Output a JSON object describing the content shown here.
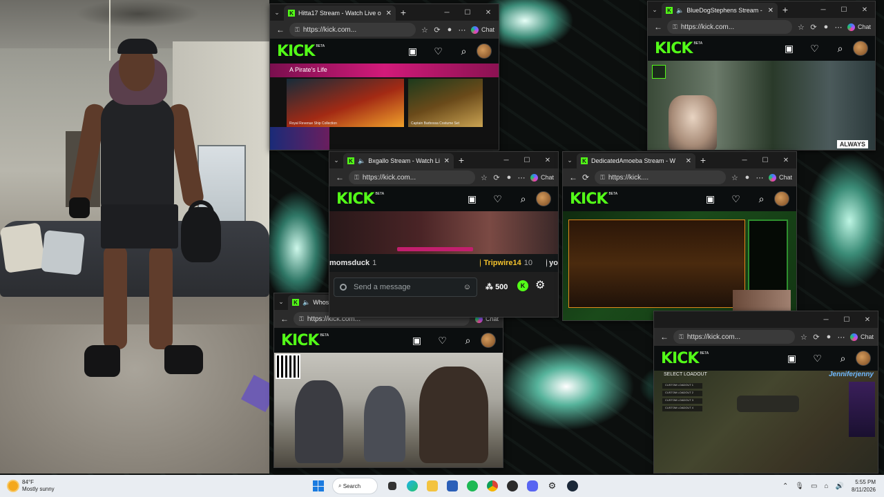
{
  "windows": {
    "hitta": {
      "title": "Hitta17 Stream - Watch Live o",
      "url": "https://kick.com...",
      "banner": "A Pirate's Life",
      "caption1": "Royal Revenue Ship Collection",
      "caption2": "Captain Barbossa Costume Set"
    },
    "blue": {
      "title": "BlueDogStephens Stream - W",
      "url": "https://kick.com...",
      "overlay": "ALWAYS"
    },
    "bxg": {
      "title": "Bxgallo Stream - Watch Live o",
      "url": "https://kick.com...",
      "chat_user": "momsduck",
      "chat_num": "1",
      "chat_user2": "Tripwire14",
      "chat_num2": "10",
      "chat_user3": "yo",
      "message_placeholder": "Send a message",
      "points": "500"
    },
    "amo": {
      "title": "DedicatedAmoeba Stream - W",
      "url": "https://kick...."
    },
    "who": {
      "title": "Whos",
      "url": "https://kick.com...",
      "chat": "Chat"
    },
    "jen": {
      "url": "https://kick.com...",
      "overlay_title": "SELECT LOADOUT",
      "streamer": "Jenniferjenny",
      "loadouts": [
        "CUSTOM LOADOUT 1",
        "CUSTOM LOADOUT 2",
        "CUSTOM LOADOUT 3",
        "CUSTOM LOADOUT 4"
      ]
    }
  },
  "common": {
    "chat": "Chat",
    "kick_logo": "KICK",
    "beta": "BETA"
  },
  "taskbar": {
    "temp": "84°F",
    "weather": "Mostly sunny",
    "search": "Search",
    "time": "5:55 PM",
    "date": "8/11/2026"
  },
  "colors": {
    "kick_green": "#53fc18",
    "taskbar_bg": "#e9edf2"
  }
}
